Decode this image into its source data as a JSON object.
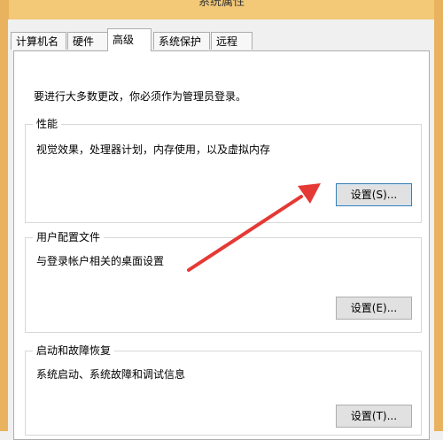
{
  "window": {
    "title": "系统属性"
  },
  "tabs": [
    {
      "label": "计算机名",
      "active": false
    },
    {
      "label": "硬件",
      "active": false
    },
    {
      "label": "高级",
      "active": true
    },
    {
      "label": "系统保护",
      "active": false
    },
    {
      "label": "远程",
      "active": false
    }
  ],
  "admin_note": "要进行大多数更改，你必须作为管理员登录。",
  "groups": {
    "performance": {
      "title": "性能",
      "description": "视觉效果，处理器计划，内存使用，以及虚拟内存",
      "button": "设置(S)..."
    },
    "user_profiles": {
      "title": "用户配置文件",
      "description": "与登录帐户相关的桌面设置",
      "button": "设置(E)..."
    },
    "startup_recovery": {
      "title": "启动和故障恢复",
      "description": "系统启动、系统故障和调试信息",
      "button": "设置(T)..."
    }
  },
  "colors": {
    "title_bar": "#f3c877",
    "arrow": "#e53935",
    "focus_border": "#3c7fb1"
  }
}
